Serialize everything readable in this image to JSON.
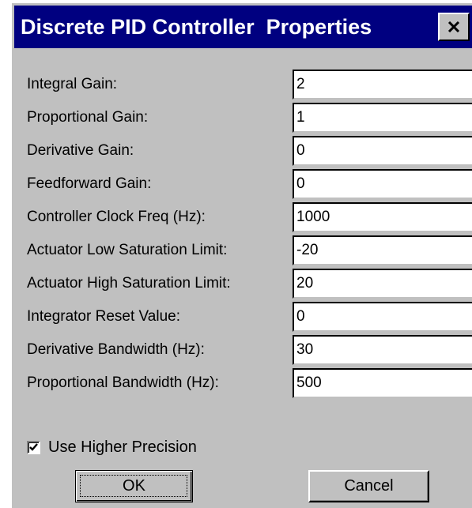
{
  "window": {
    "title": "Discrete PID Controller  Properties",
    "close_icon": "close-icon"
  },
  "fields": [
    {
      "label": "Integral Gain:",
      "value": "2"
    },
    {
      "label": "Proportional Gain:",
      "value": "1"
    },
    {
      "label": "Derivative Gain:",
      "value": "0"
    },
    {
      "label": "Feedforward Gain:",
      "value": "0"
    },
    {
      "label": "Controller Clock Freq (Hz):",
      "value": "1000"
    },
    {
      "label": "Actuator Low Saturation Limit:",
      "value": "-20"
    },
    {
      "label": "Actuator High Saturation Limit:",
      "value": "20"
    },
    {
      "label": "Integrator Reset Value:",
      "value": "0"
    },
    {
      "label": "Derivative Bandwidth  (Hz):",
      "value": "30"
    },
    {
      "label": "Proportional Bandwidth  (Hz):",
      "value": "500"
    }
  ],
  "options": {
    "higher_precision_label": "Use Higher Precision",
    "higher_precision_checked": true
  },
  "buttons": {
    "ok_label": "OK",
    "cancel_label": "Cancel"
  },
  "colors": {
    "title_bar": "#000080",
    "dialog_face": "#c0c0c0"
  }
}
